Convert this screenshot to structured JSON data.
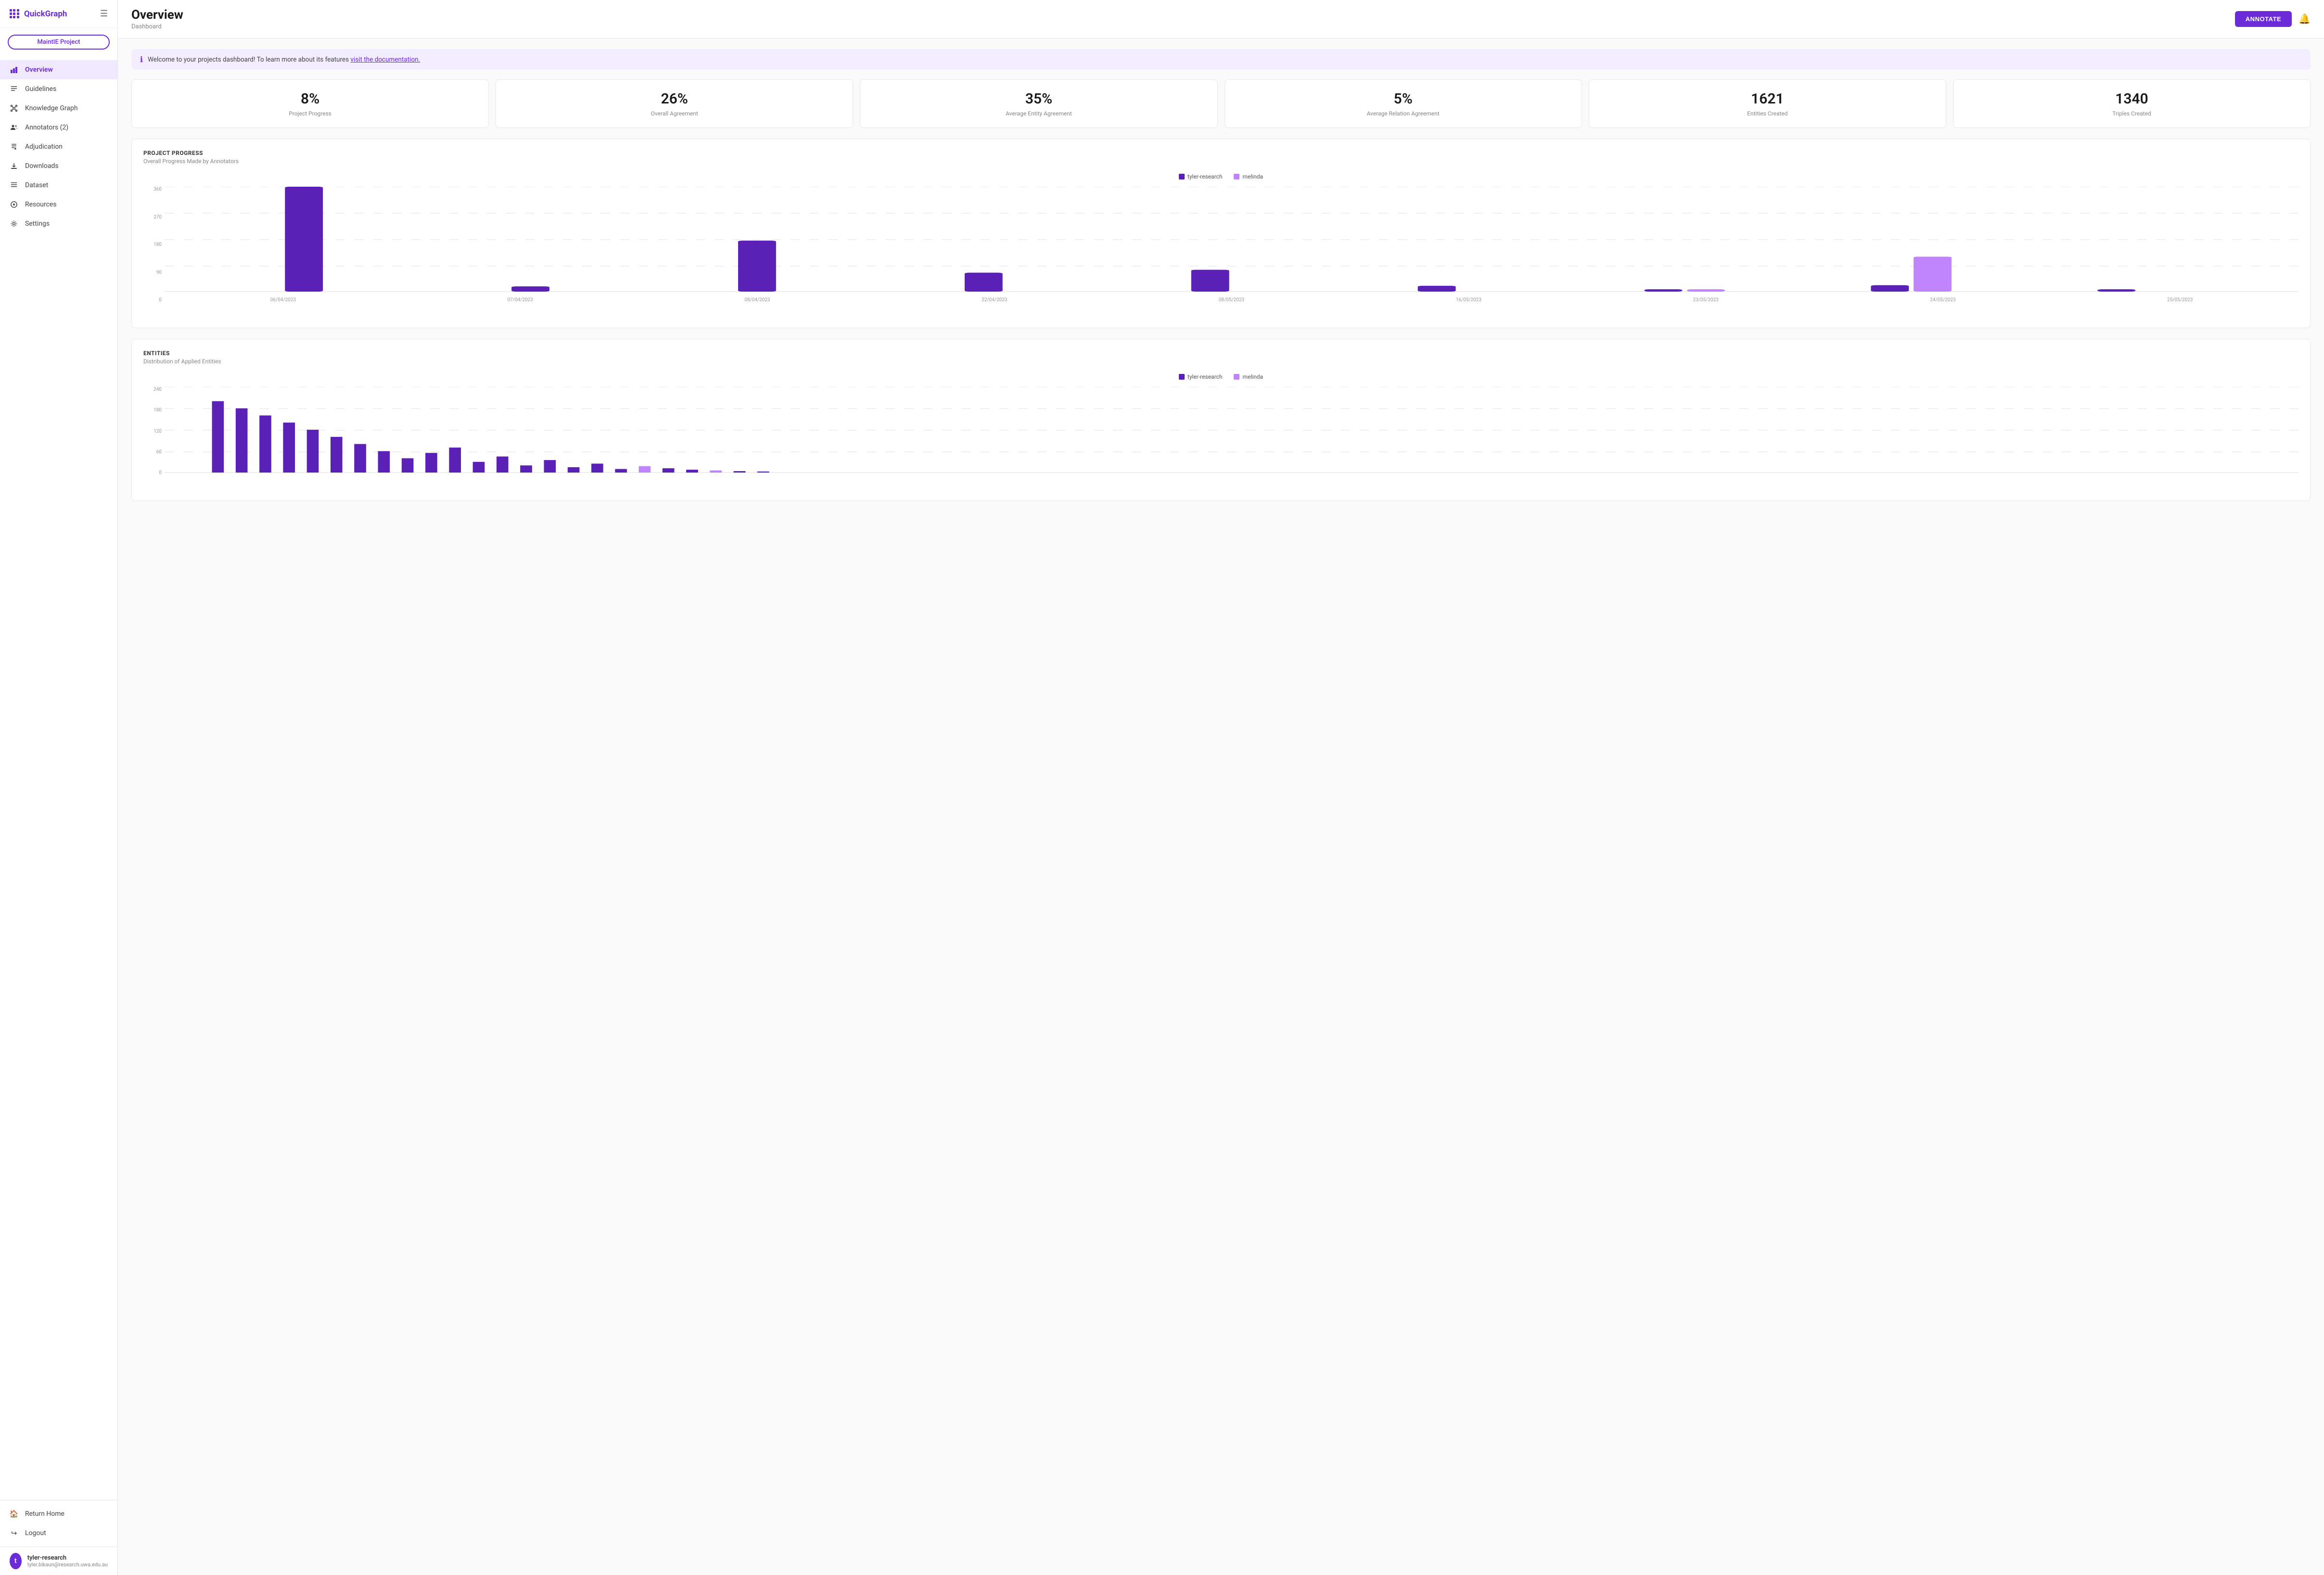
{
  "app": {
    "name": "QuickGraph",
    "project": "MaintIE Project"
  },
  "sidebar": {
    "nav_items": [
      {
        "id": "overview",
        "label": "Overview",
        "icon": "bar-chart",
        "active": true
      },
      {
        "id": "guidelines",
        "label": "Guidelines",
        "icon": "doc"
      },
      {
        "id": "knowledge-graph",
        "label": "Knowledge Graph",
        "icon": "graph"
      },
      {
        "id": "annotators",
        "label": "Annotators (2)",
        "icon": "people"
      },
      {
        "id": "adjudication",
        "label": "Adjudication",
        "icon": "tools"
      },
      {
        "id": "downloads",
        "label": "Downloads",
        "icon": "download"
      },
      {
        "id": "dataset",
        "label": "Dataset",
        "icon": "dataset"
      },
      {
        "id": "resources",
        "label": "Resources",
        "icon": "puzzle"
      },
      {
        "id": "settings",
        "label": "Settings",
        "icon": "gear"
      }
    ],
    "footer_items": [
      {
        "id": "return-home",
        "label": "Return Home",
        "icon": "home"
      },
      {
        "id": "logout",
        "label": "Logout",
        "icon": "logout"
      }
    ],
    "user": {
      "name": "tyler-research",
      "email": "tyler.bikaun@research.uwa.edu.au",
      "initial": "t"
    }
  },
  "header": {
    "title": "Overview",
    "subtitle": "Dashboard",
    "annotate_label": "ANNOTATE"
  },
  "banner": {
    "text": "Welcome to your projects dashboard! To learn more about its features ",
    "link_text": "visit the documentation."
  },
  "stats": [
    {
      "value": "8%",
      "label": "Project Progress"
    },
    {
      "value": "26%",
      "label": "Overall Agreement"
    },
    {
      "value": "35%",
      "label": "Average Entity Agreement"
    },
    {
      "value": "5%",
      "label": "Average Relation Agreement"
    },
    {
      "value": "1621",
      "label": "Entities Created"
    },
    {
      "value": "1340",
      "label": "Triples Created"
    }
  ],
  "progress_chart": {
    "title": "PROJECT PROGRESS",
    "subtitle": "Overall Progress Made by Annotators",
    "legend": [
      {
        "name": "tyler-research",
        "color": "#5b21b6"
      },
      {
        "name": "melinda",
        "color": "#c084fc"
      }
    ],
    "y_labels": [
      "0",
      "90",
      "180",
      "270",
      "360"
    ],
    "x_labels": [
      "06/04/2023",
      "07/04/2023",
      "08/04/2023",
      "22/04/2023",
      "08/05/2023",
      "16/05/2023",
      "23/05/2023",
      "24/05/2023",
      "25/05/2023"
    ],
    "bars": [
      {
        "tyler": 360,
        "melinda": 0
      },
      {
        "tyler": 18,
        "melinda": 0
      },
      {
        "tyler": 175,
        "melinda": 0
      },
      {
        "tyler": 65,
        "melinda": 0
      },
      {
        "tyler": 75,
        "melinda": 0
      },
      {
        "tyler": 20,
        "melinda": 0
      },
      {
        "tyler": 8,
        "melinda": 8
      },
      {
        "tyler": 22,
        "melinda": 120
      },
      {
        "tyler": 8,
        "melinda": 0
      }
    ],
    "max": 360
  },
  "entities_chart": {
    "title": "ENTITIES",
    "subtitle": "Distribution of Applied Entities",
    "legend": [
      {
        "name": "tyler-research",
        "color": "#5b21b6"
      },
      {
        "name": "melinda",
        "color": "#c084fc"
      }
    ],
    "y_labels": [
      "0",
      "60",
      "120",
      "180",
      "240"
    ]
  }
}
